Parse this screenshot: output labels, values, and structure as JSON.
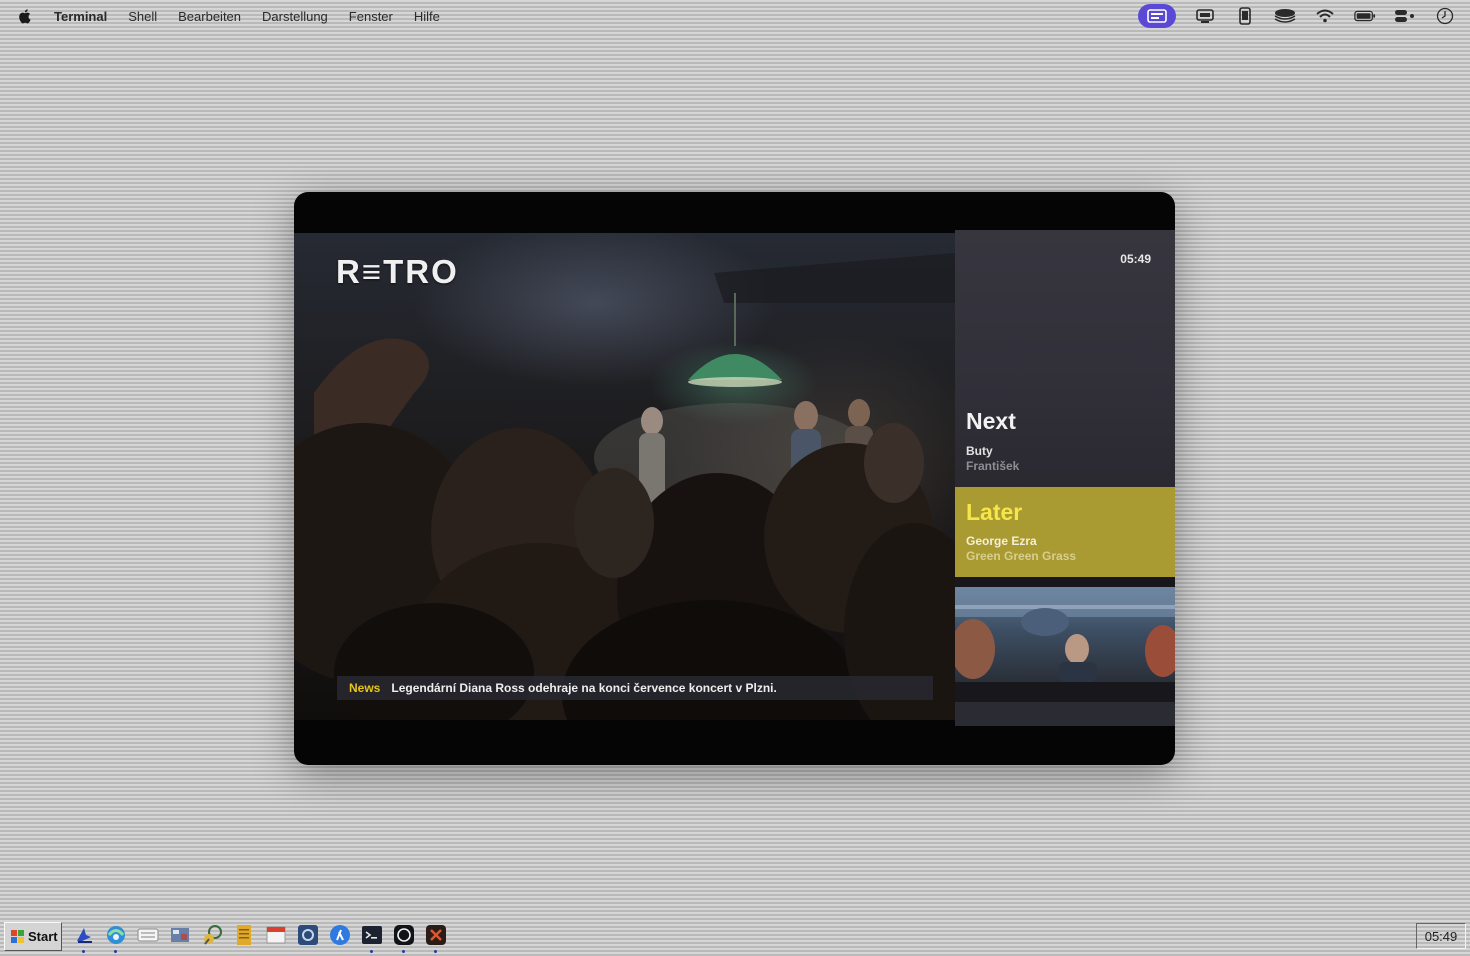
{
  "menubar": {
    "app_name": "Terminal",
    "items": [
      "Shell",
      "Bearbeiten",
      "Darstellung",
      "Fenster",
      "Hilfe"
    ],
    "status_icons": [
      "screen-mirroring-icon",
      "display-icon",
      "phone-icon",
      "stack-icon",
      "wifi-icon",
      "battery-icon",
      "control-center-icon",
      "clock-icon"
    ]
  },
  "player": {
    "logo": "R≡TRO",
    "clock": "05:49",
    "next": {
      "heading": "Next",
      "artist": "Buty",
      "title": "František"
    },
    "later": {
      "heading": "Later",
      "artist": "George Ezra",
      "title": "Green Green Grass"
    },
    "ticker": {
      "tag": "News",
      "text": "Legendární Diana Ross odehraje na konci července koncert v Plzni."
    },
    "colors": {
      "later_bg": "#a99a31",
      "later_heading": "#f7e64a",
      "ticker_tag": "#e6c419"
    }
  },
  "taskbar": {
    "start_label": "Start",
    "clock": "05:49",
    "icons": [
      "finder-icon",
      "browser-icon",
      "keyboard-icon",
      "photos-icon",
      "network-icon",
      "notes-icon",
      "calendar-icon",
      "system-settings-icon",
      "app-store-icon",
      "terminal-icon",
      "chatgpt-icon",
      "app-icon"
    ]
  }
}
